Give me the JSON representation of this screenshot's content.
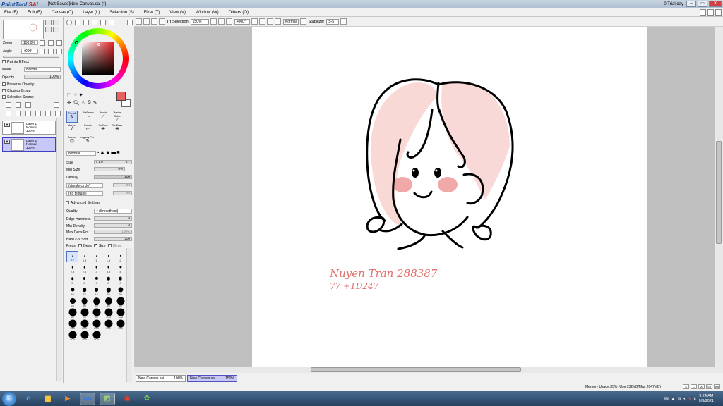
{
  "window": {
    "app_logo_prefix": "PaintTool",
    "app_logo_name": "SAI",
    "document_title": "[Not Saved]New Canvas.sai (*)",
    "trial": "0 Trial day"
  },
  "menubar": {
    "items": [
      "File (F)",
      "Edit (E)",
      "Canvas (C)",
      "Layer (L)",
      "Selection (S)",
      "Filter (T)",
      "View (V)",
      "Window (W)",
      "Others (O)"
    ]
  },
  "navigator": {
    "zoom_label": "Zoom",
    "zoom_value": "150.0%",
    "angle_label": "Angle",
    "angle_value": "+000°"
  },
  "layer_panel": {
    "paint_effect": "Paints Effect",
    "mode_label": "Mode",
    "mode_value": "Normal",
    "opacity_label": "Opacity",
    "opacity_value": "100%",
    "preserve_opacity": "Preserve Opacity",
    "clipping_group": "Clipping Group",
    "selection_source": "Selection Source",
    "layers": [
      {
        "name": "Layer 1",
        "mode": "Normal",
        "opacity": "100%"
      },
      {
        "name": "Layer 2",
        "mode": "Normal",
        "opacity": "100%"
      }
    ]
  },
  "tools": {
    "selection_label": "Selection",
    "row1": [
      "Pencil",
      "AirBrush",
      "Brush",
      "Water Color"
    ],
    "row2": [
      "Marker",
      "Eraser",
      "SelPen",
      "SelEras"
    ],
    "row3": [
      "Bucket",
      "Legacy Pen"
    ]
  },
  "brush_settings": {
    "blend_mode": "Normal",
    "size_label": "Size",
    "size_mult": "x 1.0",
    "size_value": "0.7",
    "min_size_label": "Min Size",
    "min_size_value": "0%",
    "density_label": "Density",
    "density_value": "100",
    "shape": "(simple circle)",
    "shape_value": "50",
    "texture": "(no texture)",
    "texture_value": "95",
    "advanced_label": "Advanced Settings",
    "quality_label": "Quality",
    "quality_value": "4 (Smoothest)",
    "edge_label": "Edge Hardness",
    "edge_value": "0",
    "min_density_label": "Min Density",
    "min_density_value": "0",
    "max_dens_label": "Max Dens Prs.",
    "max_dens_value": "100%",
    "hard_soft_label_hard": "Hard",
    "hard_soft_label_soft": "Soft",
    "hard_soft_value": "200",
    "press_label": "Press:",
    "press_dens": "Dens",
    "press_size": "Size",
    "press_blend": "Blend"
  },
  "brush_sizes": [
    "0.7",
    "0.8",
    "1",
    "1.5",
    "2",
    "2.3",
    "2.6",
    "3",
    "3.5",
    "4",
    "5",
    "6",
    "7",
    "8",
    "9",
    "10",
    "12",
    "14",
    "16",
    "20",
    "25",
    "30",
    "35",
    "40",
    "50",
    "60",
    "70",
    "80",
    "100",
    "120",
    "160",
    "200",
    "250",
    "300",
    "350",
    "400",
    "450",
    "500"
  ],
  "canvas_toolbar": {
    "selection_label": "Selection",
    "zoom": "150%",
    "angle": "+000°",
    "mode": "Normal",
    "stabilizer_label": "Stabilizer",
    "stabilizer_value": "S-5"
  },
  "canvas_text": {
    "line1": "Nuyen Tran 288387",
    "line2": "77 +1D247"
  },
  "doc_tabs": [
    {
      "name": "New Canvas.sai",
      "zoom": "100%"
    },
    {
      "name": "New Canvas.sai",
      "zoom": "150%"
    }
  ],
  "status": {
    "memory": "Memory Usage:35% (Use:732MB/Max:2047MB)"
  },
  "taskbar": {
    "lang": "EN",
    "time": "9:24 AM",
    "date": "9/3/2021"
  },
  "colors": {
    "accent": "#e86060",
    "selected_layer": "#c8c8f8"
  }
}
